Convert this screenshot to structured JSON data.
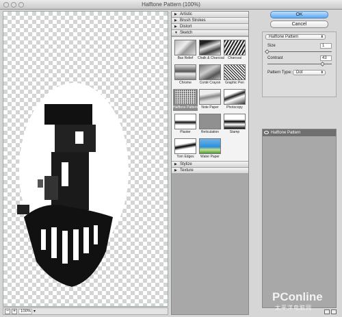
{
  "window": {
    "title": "Halftone Pattern (100%)"
  },
  "preview": {
    "zoom": "100%",
    "zoom_out": "−",
    "zoom_in": "+"
  },
  "gallery": {
    "categories_top": [
      "Artistic",
      "Brush Strokes",
      "Distort",
      "Sketch"
    ],
    "categories_bottom": [
      "Stylize",
      "Texture"
    ],
    "thumbnails": [
      {
        "label": "Bas Relief"
      },
      {
        "label": "Chalk & Charcoal"
      },
      {
        "label": "Charcoal"
      },
      {
        "label": "Chrome"
      },
      {
        "label": "Conté Crayon"
      },
      {
        "label": "Graphic Pen"
      },
      {
        "label": "Halftone Pattern",
        "selected": true
      },
      {
        "label": "Note Paper"
      },
      {
        "label": "Photocopy"
      },
      {
        "label": "Plaster"
      },
      {
        "label": "Reticulation"
      },
      {
        "label": "Stamp"
      },
      {
        "label": "Torn Edges"
      },
      {
        "label": "Water Paper"
      }
    ]
  },
  "dialog": {
    "ok_label": "OK",
    "cancel_label": "Cancel",
    "filter_select": "Halftone Pattern",
    "size_label": "Size",
    "size_value": "1",
    "size_fraction": 0.0,
    "contrast_label": "Contrast",
    "contrast_value": "43",
    "contrast_fraction": 0.86,
    "pattern_type_label": "Pattern Type:",
    "pattern_type_value": "Dot"
  },
  "layers": {
    "items": [
      {
        "label": "Halftone Pattern"
      }
    ]
  },
  "watermark": {
    "brand": "PConline",
    "cn": "太平洋电脑网"
  },
  "colors": {
    "accent": "#5ea8f0",
    "selected_layer": "#6f6f6f",
    "panel_bg": "#a8a8a8"
  }
}
